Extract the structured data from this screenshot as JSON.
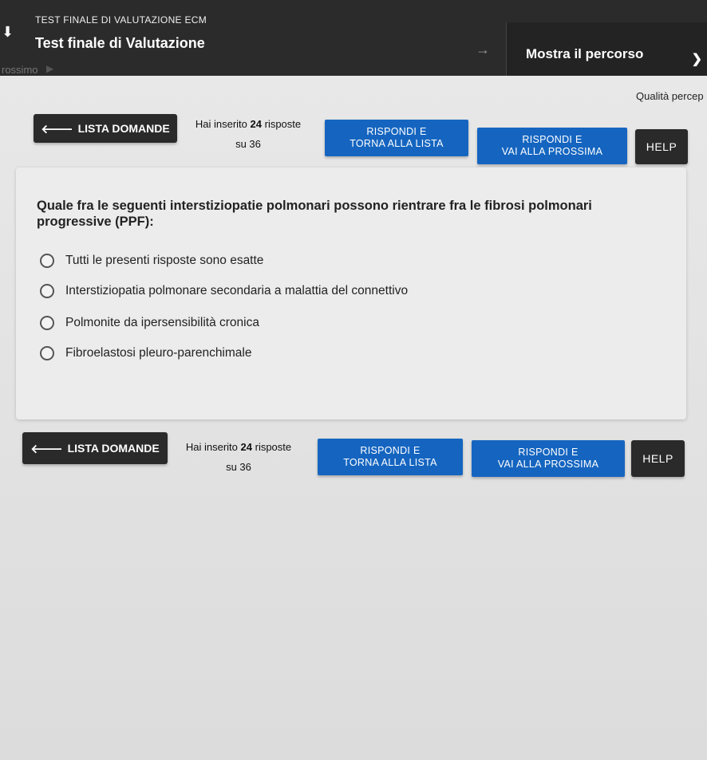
{
  "header": {
    "kicker": "TEST FINALE DI VALUTAZIONE ECM",
    "title": "Test finale di Valutazione",
    "path_button": "Mostra il percorso"
  },
  "subheader": {
    "next_label": "rossimo",
    "quality_label": "Qualità percep"
  },
  "toolbar": {
    "list_label": "LISTA DOMANDE",
    "answered_prefix": "Hai inserito",
    "answered_count": "24",
    "answered_suffix": "risposte",
    "answered_total": "su 36",
    "respond_back_line1": "RISPONDI E",
    "respond_back_line2": "TORNA ALLA LISTA",
    "respond_next_line1": "RISPONDI E",
    "respond_next_line2": "VAI ALLA PROSSIMA",
    "help_label": "HELP"
  },
  "question": {
    "text": "Quale fra le seguenti interstiziopatie polmonari possono rientrare fra le fibrosi polmonari progressive (PPF):",
    "options": [
      "Tutti le presenti risposte sono esatte",
      "Interstiziopatia polmonare secondaria a malattia del connettivo",
      "Polmonite da ipersensibilità cronica",
      "Fibroelastosi pleuro-parenchimale"
    ]
  },
  "icons": {
    "back_arrow": "arrow-left-icon",
    "download": "arrow-down-icon",
    "forward": "arrow-right-icon",
    "play": "triangle-right-icon",
    "chevron": "chevron-right-icon"
  },
  "colors": {
    "header_bg": "#2b2b2b",
    "primary_blue": "#1565c0",
    "dark_button": "#2a2a2a",
    "page_bg": "#e6e6e6"
  }
}
